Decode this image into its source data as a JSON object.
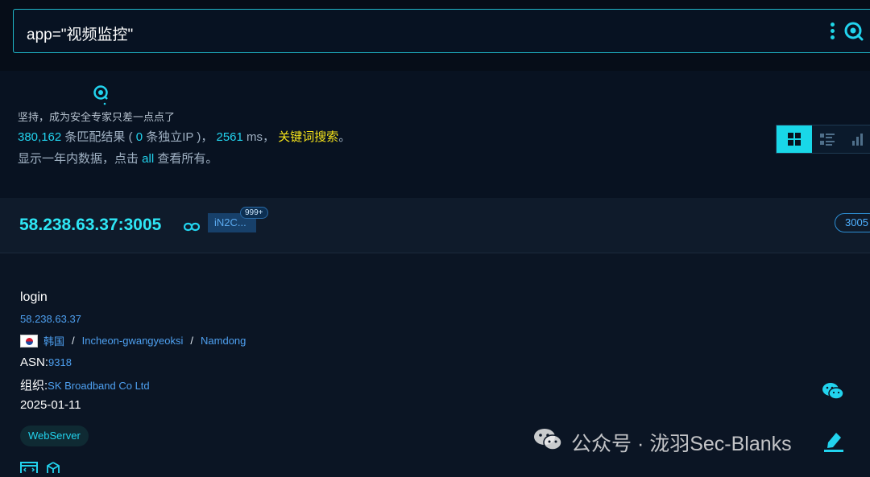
{
  "search": {
    "query": "app=\"视频监控\""
  },
  "info": {
    "slogan": "坚持，成为安全专家只差一点点了",
    "stats": {
      "total": "380,162",
      "total_suffix": " 条匹配结果 (",
      "unique_ip": " 0",
      "unique_ip_suffix": " 条独立IP )，",
      "time": " 2561",
      "time_suffix": " ms，",
      "keyword_search": " 关键词搜索",
      "end": "。"
    },
    "note": {
      "prefix": "显示一年内数据，点击 ",
      "link": "all",
      "suffix": " 查看所有。"
    }
  },
  "views": [
    "grid-view",
    "list-view",
    "chart-view"
  ],
  "result": {
    "ip_port": "58.238.63.37:3005",
    "title_tag": "iN2C...",
    "count_badge": "999+",
    "port": "3005",
    "title": "login",
    "ip": "58.238.63.37",
    "country": "韩国",
    "region": "Incheon-gwangyeoksi",
    "city": "Namdong",
    "sep": "/",
    "asn_label": "ASN:",
    "asn": "9318",
    "org_label": "组织:",
    "org": "SK Broadband Co Ltd",
    "date": "2025-01-11",
    "tech_tag": "WebServer"
  },
  "watermark": {
    "text": "公众号 · 泷羽Sec-Blanks"
  },
  "colors": {
    "accent": "#22d3ee",
    "keyword": "#f5e31a",
    "link": "#4ea0f0",
    "background": "#0b1524"
  }
}
